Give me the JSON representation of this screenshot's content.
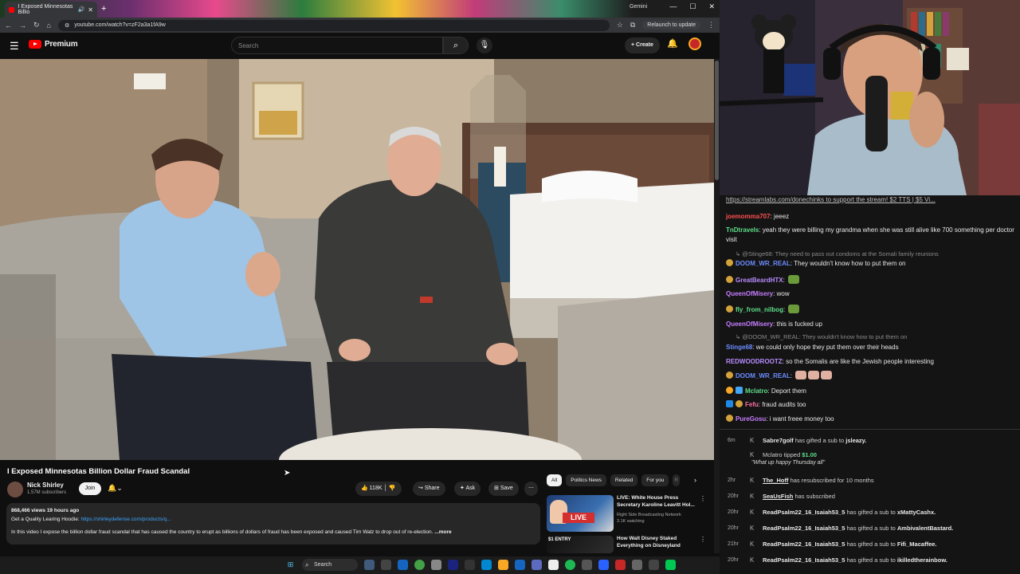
{
  "browser": {
    "tab_title": "I Exposed Minnesotas Billio",
    "new_tab": "+",
    "gemini": "Gemini",
    "url": "youtube.com/watch?v=zF2a3a1fA9w",
    "relaunch": "Relaunch to update"
  },
  "youtube": {
    "logo": "Premium",
    "search_placeholder": "Search",
    "create": "Create",
    "video_title": "I Exposed Minnesotas Billion Dollar Fraud Scandal",
    "channel_name": "Nick Shirley",
    "subscribers": "1.57M subscribers",
    "join": "Join",
    "likes": "118K",
    "share": "Share",
    "ask": "Ask",
    "save": "Save",
    "desc_meta": "868,466 views  19 hours ago",
    "desc_line1": "Get a Quality Learing Hoodie: ",
    "desc_link": "https://shirleydefense.com/products/q...",
    "desc_line2": "In this video I expose the billion dollar fraud scandal that has caused the country to erupt as billions of dollars of fraud has been exposed and caused Tim Walz to drop out of re-election.",
    "desc_more": "...more",
    "chips": [
      "All",
      "Politics News",
      "Related",
      "For you",
      "R"
    ],
    "recs": [
      {
        "title": "LIVE: White House Press Secretary Karoline Leavitt Hol...",
        "channel": "Right Side Broadcasting Network",
        "meta": "3.1K watching",
        "badge": "LIVE"
      },
      {
        "title": "How Walt Disney Staked Everything on Disneyland",
        "channel": "",
        "meta": "",
        "badge": "$1 ENTRY"
      }
    ]
  },
  "taskbar": {
    "search": "Search"
  },
  "chat": {
    "banner": "https://streamlabs.com/donechinks to support the stream! $2 TTS | $5 Vi...",
    "messages": [
      {
        "user": "joemomma707",
        "color": "#ff4f4f",
        "text": "jeeez"
      },
      {
        "user": "TnDtravels",
        "color": "#5fdf8a",
        "text": "yeah they were billing my grandma when she was still alive like 700 something per doctor visit"
      },
      {
        "reply": "@Stinge68: They need to pass out condoms at the Somali family reunions"
      },
      {
        "user": "DOOM_WR_REAL",
        "color": "#6b8cff",
        "text": "They wouldn't know how to put them on"
      },
      {
        "user": "GreatBeardHTX",
        "color": "#b98cff",
        "text": ""
      },
      {
        "user": "QueenOfMisery",
        "color": "#c77dff",
        "text": "wow"
      },
      {
        "user": "fly_from_nilbog",
        "color": "#5fdf8a",
        "text": ""
      },
      {
        "user": "QueenOfMisery",
        "color": "#c77dff",
        "text": "this is fucked up"
      },
      {
        "reply": "@DOOM_WR_REAL: They wouldn't know how to put them on"
      },
      {
        "user": "Stinge68",
        "color": "#6b8cff",
        "text": "we could only hope they put them over their heads"
      },
      {
        "user": "REDWOODROOTZ",
        "color": "#b98cff",
        "text": "so the Somalis are like the Jewish people interesting"
      },
      {
        "user": "DOOM_WR_REAL",
        "color": "#6b8cff",
        "text": ""
      },
      {
        "user": "Mclatro",
        "color": "#5fdf8a",
        "text": "Deport them"
      },
      {
        "user": "Fefu",
        "color": "#ff6fa8",
        "text": "fraud audits too"
      },
      {
        "user": "PureGosu",
        "color": "#c77dff",
        "text": "i want freee money too"
      }
    ],
    "events": [
      {
        "time": "6m",
        "user": "Sabre7golf",
        "text": " has gifted a sub to ",
        "target": "jsleazy."
      },
      {
        "time": "",
        "user": "Mclatro",
        "text": " tipped ",
        "target": "$1.00",
        "note": "\"What up happy Thursday all\""
      },
      {
        "time": "2hr",
        "user": "The_Hoff",
        "text": " has resubscribed for 10 months",
        "target": ""
      },
      {
        "time": "20hr",
        "user": "SeaUsFish",
        "text": " has subscribed",
        "target": ""
      },
      {
        "time": "20hr",
        "user": "ReadPsalm22_16_Isaiah53_5",
        "text": " has gifted a sub to ",
        "target": "xMattyCashx."
      },
      {
        "time": "20hr",
        "user": "ReadPsalm22_16_Isaiah53_5",
        "text": " has gifted a sub to ",
        "target": "AmbivalentBastard."
      },
      {
        "time": "21hr",
        "user": "ReadPsalm22_16_Isaiah53_5",
        "text": " has gifted a sub to ",
        "target": "Fifi_Macaffee."
      },
      {
        "time": "20hr",
        "user": "ReadPsalm22_16_Isaiah53_5",
        "text": " has gifted a sub to ",
        "target": "ikilledtherainbow."
      }
    ]
  },
  "colors": {
    "yt_red": "#ff0000",
    "link": "#3ea6ff",
    "donation_green": "#5fdf8a"
  }
}
